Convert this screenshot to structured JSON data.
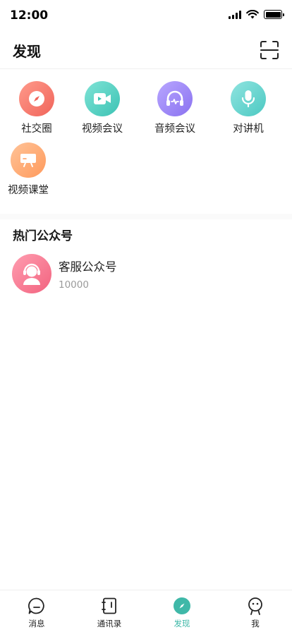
{
  "status_bar": {
    "time": "12:00"
  },
  "header": {
    "title": "发现"
  },
  "apps": [
    {
      "label": "社交圈",
      "icon": "compass-icon",
      "gradient": [
        "#ff9a8b",
        "#f0645a"
      ]
    },
    {
      "label": "视频会议",
      "icon": "video-camera-icon",
      "gradient": [
        "#7fe3d6",
        "#3cc3b4"
      ]
    },
    {
      "label": "音频会议",
      "icon": "headphones-icon",
      "gradient": [
        "#b8a6ff",
        "#8a72f0"
      ]
    },
    {
      "label": "对讲机",
      "icon": "microphone-icon",
      "gradient": [
        "#8fe4e0",
        "#4cc9c2"
      ]
    },
    {
      "label": "视频课堂",
      "icon": "projector-screen-icon",
      "gradient": [
        "#ffc398",
        "#ff9a5c"
      ]
    }
  ],
  "hot_accounts": {
    "title": "热门公众号",
    "items": [
      {
        "name": "客服公众号",
        "id": "10000",
        "icon": "customer-service-icon"
      }
    ]
  },
  "tab_bar": {
    "items": [
      {
        "label": "消息",
        "icon": "chat-bubble-icon",
        "active": false
      },
      {
        "label": "通讯录",
        "icon": "contacts-book-icon",
        "active": false
      },
      {
        "label": "发现",
        "icon": "compass-icon",
        "active": true
      },
      {
        "label": "我",
        "icon": "person-icon",
        "active": false
      }
    ],
    "active_color": "#3fb8a8"
  }
}
